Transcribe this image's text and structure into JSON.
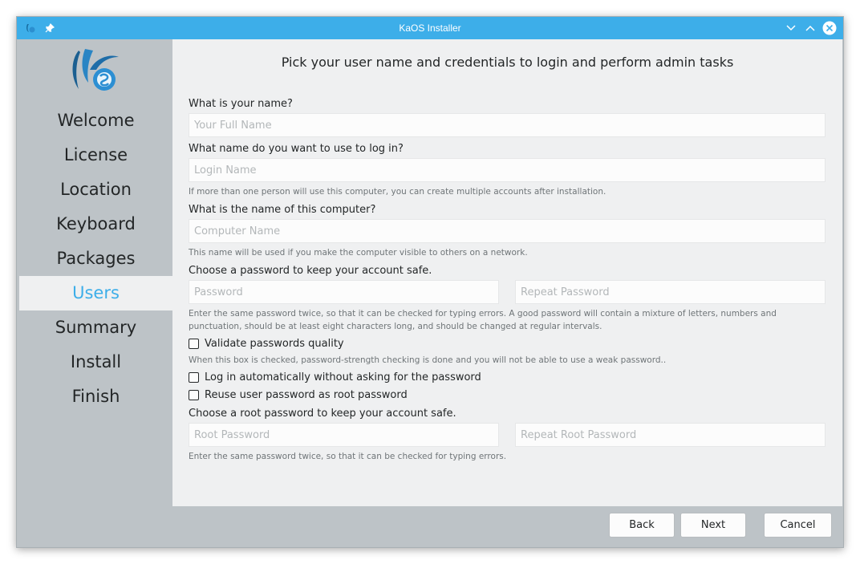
{
  "window": {
    "title": "KaOS Installer"
  },
  "sidebar": {
    "items": [
      {
        "label": "Welcome",
        "active": false
      },
      {
        "label": "License",
        "active": false
      },
      {
        "label": "Location",
        "active": false
      },
      {
        "label": "Keyboard",
        "active": false
      },
      {
        "label": "Packages",
        "active": false
      },
      {
        "label": "Users",
        "active": true
      },
      {
        "label": "Summary",
        "active": false
      },
      {
        "label": "Install",
        "active": false
      },
      {
        "label": "Finish",
        "active": false
      }
    ]
  },
  "page": {
    "heading": "Pick your user name and credentials to login and perform admin tasks",
    "name_label": "What is your name?",
    "name_placeholder": "Your Full Name",
    "login_label": "What name do you want to use to log in?",
    "login_placeholder": "Login Name",
    "login_hint": "If more than one person will use this computer, you can create multiple accounts after installation.",
    "computer_label": "What is the name of this computer?",
    "computer_placeholder": "Computer Name",
    "computer_hint": "This name will be used if you make the computer visible to others on a network.",
    "password_label": "Choose a password to keep your account safe.",
    "password_placeholder": "Password",
    "repeat_password_placeholder": "Repeat Password",
    "password_hint": "Enter the same password twice, so that it can be checked for typing errors. A good password will contain a mixture of letters, numbers and punctuation, should be at least eight characters long, and should be changed at regular intervals.",
    "validate_label": "Validate passwords quality",
    "validate_hint": "When this box is checked, password-strength checking is done and you will not be able to use a weak password..",
    "autologin_label": "Log in automatically without asking for the password",
    "reuse_label": "Reuse user password as root password",
    "root_label": "Choose a root password to keep your account safe.",
    "root_placeholder": "Root Password",
    "repeat_root_placeholder": "Repeat Root Password",
    "root_hint": "Enter the same password twice, so that it can be checked for typing errors."
  },
  "footer": {
    "back": "Back",
    "next": "Next",
    "cancel": "Cancel"
  },
  "colors": {
    "accent": "#3daee9",
    "sidebar": "#bdc3c7",
    "content": "#eff0f1"
  }
}
